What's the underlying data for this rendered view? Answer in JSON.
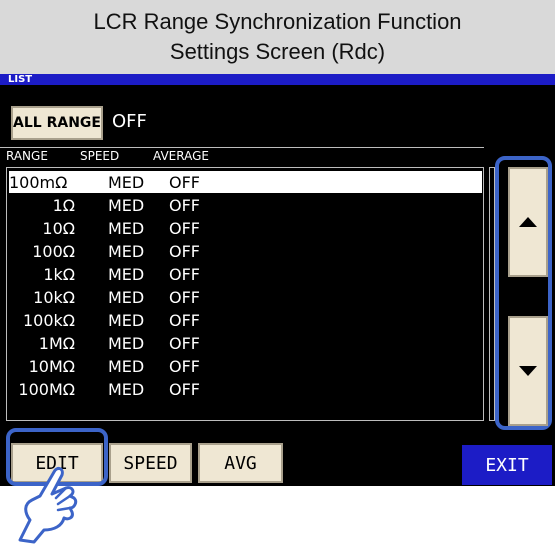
{
  "caption": {
    "line1": "LCR Range Synchronization Function",
    "line2": "Settings Screen (Rdc)"
  },
  "screen": {
    "list_title": "LIST",
    "all_range": {
      "label": "ALL RANGE",
      "value": "OFF"
    },
    "columns": {
      "range": "RANGE",
      "speed": "SPEED",
      "average": "AVERAGE"
    },
    "rows": [
      {
        "range": "100mΩ",
        "speed": "MED",
        "average": "OFF"
      },
      {
        "range": "1Ω",
        "speed": "MED",
        "average": "OFF"
      },
      {
        "range": "10Ω",
        "speed": "MED",
        "average": "OFF"
      },
      {
        "range": "100Ω",
        "speed": "MED",
        "average": "OFF"
      },
      {
        "range": "1kΩ",
        "speed": "MED",
        "average": "OFF"
      },
      {
        "range": "10kΩ",
        "speed": "MED",
        "average": "OFF"
      },
      {
        "range": "100kΩ",
        "speed": "MED",
        "average": "OFF"
      },
      {
        "range": "1MΩ",
        "speed": "MED",
        "average": "OFF"
      },
      {
        "range": "10MΩ",
        "speed": "MED",
        "average": "OFF"
      },
      {
        "range": "100MΩ",
        "speed": "MED",
        "average": "OFF"
      }
    ],
    "buttons": {
      "edit": "EDIT",
      "speed": "SPEED",
      "avg": "AVG",
      "exit": "EXIT"
    }
  },
  "colors": {
    "screen_background": "#000000",
    "button_face": "#efe7d3",
    "exit_button": "#1c1cc6",
    "highlight_frame": "#3c64c8",
    "caption_background": "#d9d9d9"
  },
  "icons": [
    "scroll-up-icon",
    "scroll-down-icon",
    "pointing-hand-icon"
  ]
}
